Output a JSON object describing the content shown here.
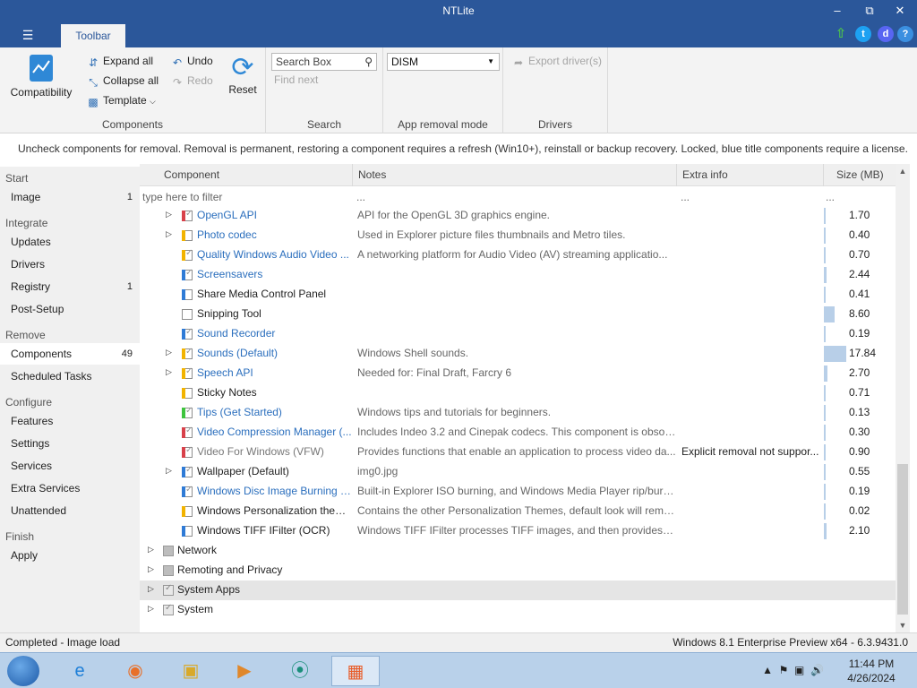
{
  "window": {
    "title": "NTLite",
    "menu_icon": "hamburger-icon",
    "active_tab": "Toolbar",
    "controls": [
      "minimize-icon",
      "restore-icon",
      "close-icon"
    ],
    "title_icons": [
      "update-arrow-icon",
      "twitter-icon",
      "discord-icon",
      "help-icon"
    ],
    "colors": {
      "titlebar": "#2b579a",
      "ribbon": "#f3f3f3",
      "blue_component": "#2a6ebd"
    }
  },
  "ribbon": {
    "components": {
      "label": "Components",
      "compatibility": "Compatibility",
      "expand_all": "Expand all",
      "collapse_all": "Collapse all",
      "template": "Template",
      "undo": "Undo",
      "redo": "Redo",
      "reset": "Reset"
    },
    "search": {
      "label": "Search",
      "placeholder": "Search Box",
      "find_next": "Find next"
    },
    "app_removal": {
      "label": "App removal mode",
      "value": "DISM"
    },
    "drivers": {
      "label": "Drivers",
      "export": "Export driver(s)"
    }
  },
  "info": "Uncheck components for removal. Removal is permanent, restoring a component requires a refresh (Win10+), reinstall or backup recovery. Locked, blue title components require a license.",
  "sidebar": {
    "start": {
      "heading": "Start",
      "items": [
        {
          "label": "Image",
          "count": "1"
        }
      ]
    },
    "integrate": {
      "heading": "Integrate",
      "items": [
        {
          "label": "Updates",
          "count": ""
        },
        {
          "label": "Drivers",
          "count": ""
        },
        {
          "label": "Registry",
          "count": "1"
        },
        {
          "label": "Post-Setup",
          "count": ""
        }
      ]
    },
    "remove": {
      "heading": "Remove",
      "items": [
        {
          "label": "Components",
          "count": "49"
        },
        {
          "label": "Scheduled Tasks",
          "count": ""
        }
      ]
    },
    "configure": {
      "heading": "Configure",
      "items": [
        {
          "label": "Features",
          "count": ""
        },
        {
          "label": "Settings",
          "count": ""
        },
        {
          "label": "Services",
          "count": ""
        },
        {
          "label": "Extra Services",
          "count": ""
        },
        {
          "label": "Unattended",
          "count": ""
        }
      ]
    },
    "finish": {
      "heading": "Finish",
      "items": [
        {
          "label": "Apply",
          "count": ""
        }
      ]
    }
  },
  "grid": {
    "columns": {
      "component": "Component",
      "notes": "Notes",
      "extra": "Extra info",
      "size": "Size (MB)"
    },
    "filter": {
      "placeholder": "type here to filter",
      "notes": "...",
      "extra": "...",
      "size": "..."
    },
    "rows": [
      {
        "name": "OpenGL API",
        "notes": "API for the OpenGL 3D graphics engine.",
        "extra": "",
        "size": "1.70",
        "size_value": 1.7,
        "expandable": true,
        "checked": true,
        "flag": "#d8414a",
        "style": "blue"
      },
      {
        "name": "Photo codec",
        "notes": "Used in Explorer picture files thumbnails and Metro tiles.",
        "extra": "",
        "size": "0.40",
        "size_value": 0.4,
        "expandable": true,
        "checked": false,
        "flag": "#f2b300",
        "style": "blue"
      },
      {
        "name": "Quality Windows Audio Video ...",
        "notes": "A networking platform for Audio Video (AV) streaming applicatio...",
        "extra": "",
        "size": "0.70",
        "size_value": 0.7,
        "expandable": false,
        "checked": true,
        "flag": "#f2b300",
        "style": "blue"
      },
      {
        "name": "Screensavers",
        "notes": "",
        "extra": "",
        "size": "2.44",
        "size_value": 2.44,
        "expandable": false,
        "checked": true,
        "flag": "#2f7bd6",
        "style": "blue"
      },
      {
        "name": "Share Media Control Panel",
        "notes": "",
        "extra": "",
        "size": "0.41",
        "size_value": 0.41,
        "expandable": false,
        "checked": false,
        "flag": "#2f7bd6",
        "style": "normal"
      },
      {
        "name": "Snipping Tool",
        "notes": "",
        "extra": "",
        "size": "8.60",
        "size_value": 8.6,
        "expandable": false,
        "checked": false,
        "flag": "",
        "style": "normal"
      },
      {
        "name": "Sound Recorder",
        "notes": "",
        "extra": "",
        "size": "0.19",
        "size_value": 0.19,
        "expandable": false,
        "checked": true,
        "flag": "#2f7bd6",
        "style": "blue"
      },
      {
        "name": "Sounds (Default)",
        "notes": "Windows Shell sounds.",
        "extra": "",
        "size": "17.84",
        "size_value": 17.84,
        "expandable": true,
        "checked": true,
        "flag": "#f2b300",
        "style": "blue"
      },
      {
        "name": "Speech API",
        "notes": "Needed for: Final Draft, Farcry 6",
        "extra": "",
        "size": "2.70",
        "size_value": 2.7,
        "expandable": true,
        "checked": true,
        "flag": "#f2b300",
        "style": "blue"
      },
      {
        "name": "Sticky Notes",
        "notes": "",
        "extra": "",
        "size": "0.71",
        "size_value": 0.71,
        "expandable": false,
        "checked": false,
        "flag": "#f2b300",
        "style": "normal"
      },
      {
        "name": "Tips (Get Started)",
        "notes": "Windows tips and tutorials for beginners.",
        "extra": "",
        "size": "0.13",
        "size_value": 0.13,
        "expandable": false,
        "checked": true,
        "flag": "#3ec43e",
        "style": "blue"
      },
      {
        "name": "Video Compression Manager (...",
        "notes": "Includes Indeo 3.2 and Cinepak codecs. This component is obsole...",
        "extra": "",
        "size": "0.30",
        "size_value": 0.3,
        "expandable": false,
        "checked": true,
        "flag": "#d8414a",
        "style": "blue"
      },
      {
        "name": "Video For Windows (VFW)",
        "notes": "Provides functions that enable an application to process video da...",
        "extra": "Explicit removal not suppor...",
        "size": "0.90",
        "size_value": 0.9,
        "expandable": false,
        "checked": true,
        "flag": "#d8414a",
        "style": "gray"
      },
      {
        "name": "Wallpaper (Default)",
        "notes": "img0.jpg",
        "extra": "",
        "size": "0.55",
        "size_value": 0.55,
        "expandable": true,
        "checked": true,
        "flag": "#2f7bd6",
        "style": "normal"
      },
      {
        "name": "Windows Disc Image Burning T...",
        "notes": "Built-in Explorer ISO burning, and Windows Media Player rip/burn...",
        "extra": "",
        "size": "0.19",
        "size_value": 0.19,
        "expandable": false,
        "checked": true,
        "flag": "#2f7bd6",
        "style": "blue"
      },
      {
        "name": "Windows Personalization themes",
        "notes": "Contains the other Personalization Themes, default look will rema...",
        "extra": "",
        "size": "0.02",
        "size_value": 0.02,
        "expandable": false,
        "checked": false,
        "flag": "#f2b300",
        "style": "normal"
      },
      {
        "name": "Windows TIFF IFilter (OCR)",
        "notes": "Windows TIFF IFilter processes TIFF images, and then provides th...",
        "extra": "",
        "size": "2.10",
        "size_value": 2.1,
        "expandable": false,
        "checked": false,
        "flag": "#2f7bd6",
        "style": "normal"
      }
    ],
    "groups": [
      {
        "name": "Network",
        "state": "partial"
      },
      {
        "name": "Remoting and Privacy",
        "state": "partial"
      },
      {
        "name": "System Apps",
        "state": "checked"
      },
      {
        "name": "System",
        "state": "checked"
      }
    ]
  },
  "status": {
    "left": "Completed - Image load",
    "right": "Windows 8.1 Enterprise Preview x64 - 6.3.9431.0"
  },
  "taskbar": {
    "apps": [
      "internet-explorer-icon",
      "firefox-icon",
      "file-explorer-icon",
      "media-player-icon",
      "app-icon",
      "ntlite-icon"
    ],
    "time": "11:44 PM",
    "date": "4/26/2024"
  }
}
